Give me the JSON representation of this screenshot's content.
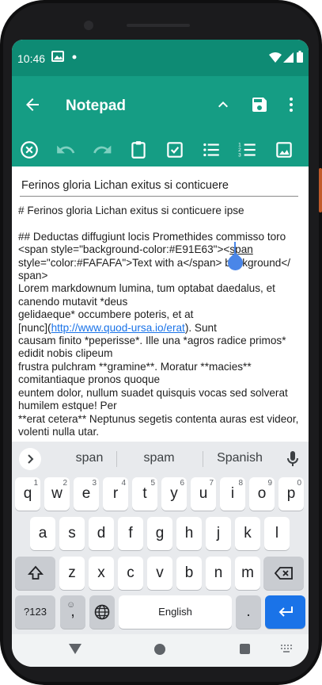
{
  "status_bar": {
    "time": "10:46",
    "icons": [
      "gallery-icon",
      "dot-icon",
      "wifi-icon",
      "signal-icon",
      "battery-icon"
    ]
  },
  "app_bar": {
    "title": "Notepad",
    "actions": [
      "collapse-toolbar-icon",
      "save-icon",
      "more-options-icon"
    ],
    "accent_color": "#159d84",
    "status_color": "#0e8b74"
  },
  "format_toolbar": {
    "buttons": [
      "clear-icon",
      "undo-icon",
      "redo-icon",
      "clipboard-icon",
      "checkbox-icon",
      "bullet-list-icon",
      "numbered-list-icon",
      "image-icon"
    ]
  },
  "editor": {
    "title_value": "Ferinos gloria Lichan exitus si conticuere",
    "line1": "# Ferinos gloria Lichan exitus si conticuere ipse",
    "line2": "## Deductas diffugiunt locis Promethides commisso toro",
    "line3a": "<span style=\"background-color:#E91E63\"><",
    "line3b": "span",
    "line4": "style=\"color:#FAFAFA\">Text with a</span>",
    "line4b": "background</",
    "line5": "span>",
    "line6": "Lorem markdownum lumina, tum optabat daedalus, et canendo mutavit *deus",
    "line7": "gelidaeque* occumbere poteris, et at",
    "line8a": "[nunc](",
    "link": "http://www.quod-ursa.io/erat",
    "line8b": "). Sunt",
    "line9": "causam finito *peperisse*. Ille una *agros radice primos* edidit nobis clipeum",
    "line10": "frustra pulchram **gramine**. Moratur **macies** comitantiaque pronos quoque",
    "line11": "euntem dolor, nullum suadet quisquis vocas sed solverat humilem estque! Per",
    "line12": "**erat cetera** Neptunus segetis contenta auras est videor, volenti nulla utar."
  },
  "keyboard": {
    "suggestions": [
      "span",
      "spam",
      "Spanish"
    ],
    "row1": [
      {
        "k": "q",
        "h": "1"
      },
      {
        "k": "w",
        "h": "2"
      },
      {
        "k": "e",
        "h": "3"
      },
      {
        "k": "r",
        "h": "4"
      },
      {
        "k": "t",
        "h": "5"
      },
      {
        "k": "y",
        "h": "6"
      },
      {
        "k": "u",
        "h": "7"
      },
      {
        "k": "i",
        "h": "8"
      },
      {
        "k": "o",
        "h": "9"
      },
      {
        "k": "p",
        "h": "0"
      }
    ],
    "row2": [
      "a",
      "s",
      "d",
      "f",
      "g",
      "h",
      "j",
      "k",
      "l"
    ],
    "row3": [
      "z",
      "x",
      "c",
      "v",
      "b",
      "n",
      "m"
    ],
    "symbols_label": "?123",
    "comma_label": ",",
    "period_label": ".",
    "space_label": "English",
    "enter_color": "#1a73e8"
  }
}
